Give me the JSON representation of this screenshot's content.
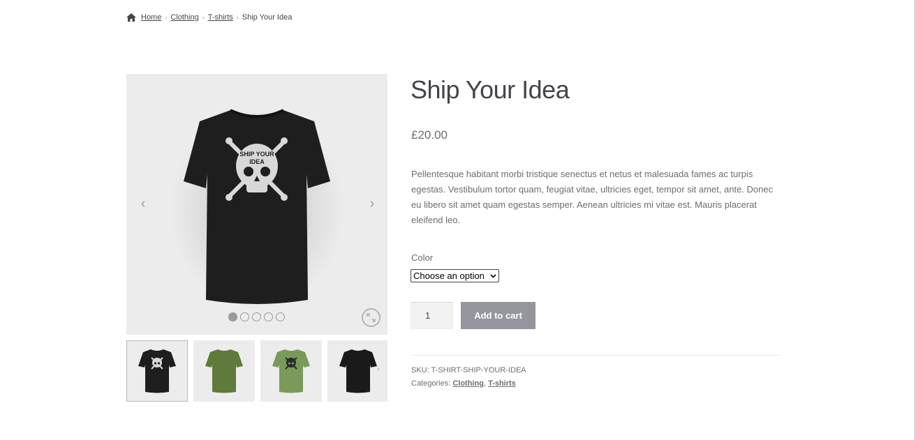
{
  "breadcrumb": {
    "home": "Home",
    "clothing": "Clothing",
    "tshirts": "T-shirts",
    "current": "Ship Your Idea",
    "separator": "›"
  },
  "gallery": {
    "prev_arrow": "‹",
    "next_arrow": "›",
    "dot_count": 5,
    "active_dot": 1,
    "thumb_next": "›",
    "thumbnails": [
      "black-skull-shirt",
      "green-plain-shirt",
      "green-skull-shirt",
      "black-back-shirt"
    ]
  },
  "product": {
    "title": "Ship Your Idea",
    "price": "£20.00",
    "description": "Pellentesque habitant morbi tristique senectus et netus et malesuada fames ac turpis egestas. Vestibulum tortor quam, feugiat vitae, ultricies eget, tempor sit amet, ante. Donec eu libero sit amet quam egestas semper. Aenean ultricies mi vitae est. Mauris placerat eleifend leo.",
    "color_label": "Color",
    "color_select": "Choose an option",
    "quantity": "1",
    "add_to_cart": "Add to cart",
    "sku_label": "SKU:",
    "sku": "T-SHIRT-SHIP-YOUR-IDEA",
    "categories_label": "Categories:",
    "category_1": "Clothing",
    "category_sep": ",",
    "category_2": "T-shirts"
  },
  "colors": {
    "text": "#6d6d6d",
    "heading": "#43454b",
    "button": "#95969d",
    "gallery_bg": "#ececec",
    "shirt_black": "#1e1e1e",
    "shirt_green": "#6f8a4a"
  }
}
